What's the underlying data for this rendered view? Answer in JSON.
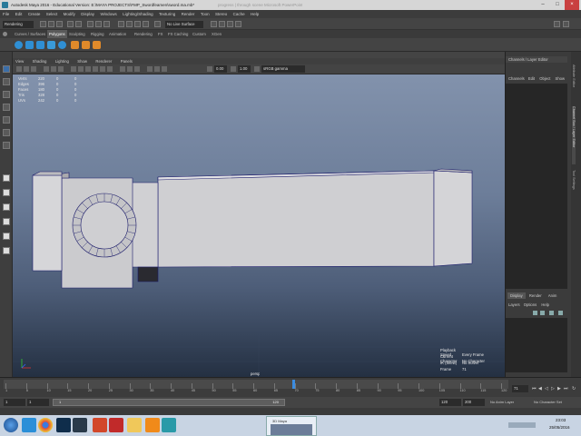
{
  "window": {
    "title": "Autodesk Maya 2016 - Educational Version: E:\\MAYA PROJECTS\\FMP_Swordfeamen\\sword.ma.mb*",
    "center_text": "progress | through scene        Microsoft PowerPoint"
  },
  "menubar": [
    "File",
    "Edit",
    "Create",
    "Select",
    "Modify",
    "Display",
    "Windows",
    "Lighting/Shading",
    "Texturing",
    "Render",
    "Toon",
    "Stereo",
    "Cache",
    "Help"
  ],
  "statusline": {
    "mode": "Rendering",
    "surface_label": "No Live Surface"
  },
  "shelf_tabs": [
    "Curves / Surfaces",
    "Polygons",
    "Sculpting",
    "Rigging",
    "Animation",
    "Rendering",
    "FX",
    "FX Caching",
    "Custom",
    "XGen"
  ],
  "active_shelf_tab": "Polygons",
  "panel_menu": [
    "View",
    "Shading",
    "Lighting",
    "Show",
    "Renderer",
    "Panels"
  ],
  "panel_fields": {
    "value1": "0.00",
    "value2": "1.00",
    "colorspace": "sRGB gamma"
  },
  "hud_stats": [
    {
      "label": "Verts",
      "v1": "220",
      "v2": "0",
      "v3": "0"
    },
    {
      "label": "Edges",
      "v1": "396",
      "v2": "0",
      "v3": "0"
    },
    {
      "label": "Faces",
      "v1": "180",
      "v2": "0",
      "v3": "0"
    },
    {
      "label": "Tris",
      "v1": "328",
      "v2": "0",
      "v3": "0"
    },
    {
      "label": "UVs",
      "v1": "242",
      "v2": "0",
      "v3": "0"
    }
  ],
  "hud_bottom_right": [
    {
      "label": "Playback Speed",
      "value": "Every Frame"
    },
    {
      "label": "Current Character",
      "value": "No Character"
    },
    {
      "label": "IK (Skew)",
      "value": "No Solver"
    },
    {
      "label": "Frame",
      "value": "71"
    }
  ],
  "camera_label": "persp",
  "right_panel": {
    "header": "Channels / Layer Editor",
    "channel_menu": [
      "Channels",
      "Edit",
      "Object",
      "Show"
    ],
    "layer_tabs": [
      "Display",
      "Render",
      "Anim"
    ],
    "layer_menu": [
      "Layers",
      "Options",
      "Help"
    ],
    "vertical_tabs": [
      "Attribute Editor",
      "Channel Box / Layer Editor",
      "Tool Settings"
    ]
  },
  "timeline": {
    "start": "1",
    "end": "120",
    "current_frame": "71",
    "range_start": "1",
    "range_end": "120",
    "anim_end": "120",
    "anim_max": "200",
    "ticks": [
      "1",
      "5",
      "10",
      "15",
      "20",
      "25",
      "30",
      "35",
      "40",
      "45",
      "50",
      "55",
      "60",
      "65",
      "70",
      "75",
      "80",
      "85",
      "90",
      "95",
      "100",
      "105",
      "110",
      "115",
      "120"
    ],
    "anim_layer": "No Anim Layer",
    "char_set": "No Character Set"
  },
  "taskbar": {
    "window_label": "3D Maya",
    "time": "23:03",
    "date": "25/05/2016"
  },
  "colors": {
    "viewport_top": "#8292ac",
    "viewport_bottom": "#243042",
    "model": "#c9c9cc",
    "model_edge": "#1a1a6a"
  }
}
